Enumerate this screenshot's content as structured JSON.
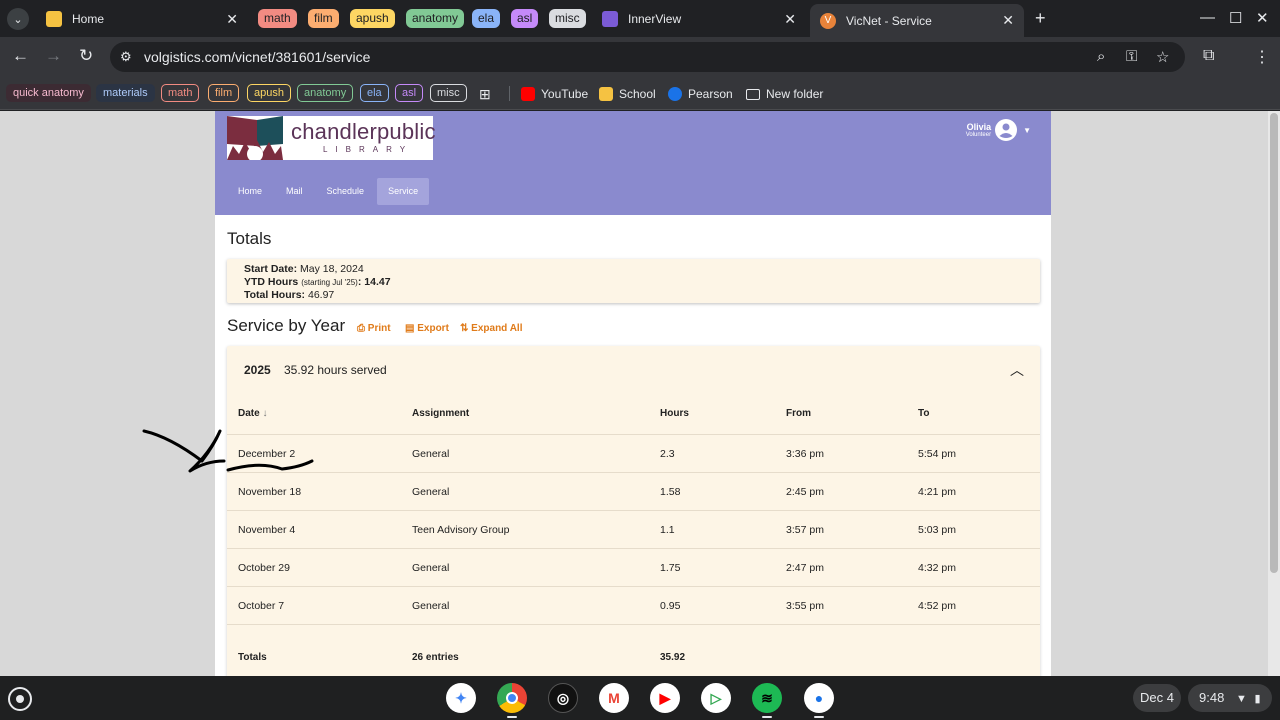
{
  "browser": {
    "tabs": [
      {
        "title": "Home",
        "favicon_color": "#f5c242"
      },
      {
        "title": "InnerView",
        "favicon_color": "#7b5bd6"
      },
      {
        "title": "VicNet - Service",
        "favicon_color": "#e8833a",
        "active": true
      }
    ],
    "tab_groups": [
      {
        "label": "math",
        "color": "#f28b82"
      },
      {
        "label": "film",
        "color": "#fcad70"
      },
      {
        "label": "apush",
        "color": "#fdd663"
      },
      {
        "label": "anatomy",
        "color": "#81c995"
      },
      {
        "label": "ela",
        "color": "#8ab4f8"
      },
      {
        "label": "asl",
        "color": "#c58af9"
      },
      {
        "label": "misc",
        "color": "#dadce0"
      }
    ],
    "url": "volgistics.com/vicnet/381601/service",
    "bookmark_groups": [
      {
        "label": "quick anatomy",
        "color": "#f48fb1"
      },
      {
        "label": "materials",
        "color": "#8ab4f8"
      },
      {
        "label": "math",
        "color": "#f28b82"
      },
      {
        "label": "film",
        "color": "#fcad70"
      },
      {
        "label": "apush",
        "color": "#fdd663"
      },
      {
        "label": "anatomy",
        "color": "#81c995"
      },
      {
        "label": "ela",
        "color": "#8ab4f8"
      },
      {
        "label": "asl",
        "color": "#c58af9"
      },
      {
        "label": "misc",
        "color": "#dadce0"
      }
    ],
    "bookmarks": [
      {
        "label": "YouTube",
        "icon": "youtube-icon",
        "color": "#ff0000"
      },
      {
        "label": "School",
        "icon": "classroom-icon",
        "color": "#f5c242"
      },
      {
        "label": "Pearson",
        "icon": "pearson-icon",
        "color": "#1a73e8"
      },
      {
        "label": "New folder",
        "icon": "folder-icon",
        "color": "#e8eaed"
      }
    ]
  },
  "site": {
    "logo_text": "chandlerpublic",
    "logo_sub": "LIBRARY",
    "user_name": "Olivia",
    "user_role": "Volunteer",
    "nav": [
      "Home",
      "Mail",
      "Schedule",
      "Service"
    ],
    "active_nav": "Service"
  },
  "totals": {
    "title": "Totals",
    "start_date_label": "Start Date:",
    "start_date": "May 18, 2024",
    "ytd_label": "YTD Hours",
    "ytd_note": "(starting Jul '25)",
    "ytd_value": ": 14.47",
    "total_label": "Total Hours:",
    "total_value": "46.97"
  },
  "service_by_year": {
    "title": "Service by Year",
    "actions": {
      "print": "Print",
      "export": "Export",
      "expand_all": "Expand All"
    },
    "year": "2025",
    "hours_served": "35.92 hours served",
    "columns": [
      "Date",
      "Assignment",
      "Hours",
      "From",
      "To"
    ],
    "rows": [
      {
        "date": "December 2",
        "assignment": "General",
        "hours": "2.3",
        "from": "3:36 pm",
        "to": "5:54 pm"
      },
      {
        "date": "November 18",
        "assignment": "General",
        "hours": "1.58",
        "from": "2:45 pm",
        "to": "4:21 pm"
      },
      {
        "date": "November 4",
        "assignment": "Teen Advisory Group",
        "hours": "1.1",
        "from": "3:57 pm",
        "to": "5:03 pm"
      },
      {
        "date": "October 29",
        "assignment": "General",
        "hours": "1.75",
        "from": "2:47 pm",
        "to": "4:32 pm"
      },
      {
        "date": "October 7",
        "assignment": "General",
        "hours": "0.95",
        "from": "3:55 pm",
        "to": "4:52 pm"
      }
    ],
    "footer": {
      "label": "Totals",
      "entries": "26 entries",
      "hours": "35.92"
    }
  },
  "shelf": {
    "date": "Dec 4",
    "time": "9:48"
  }
}
